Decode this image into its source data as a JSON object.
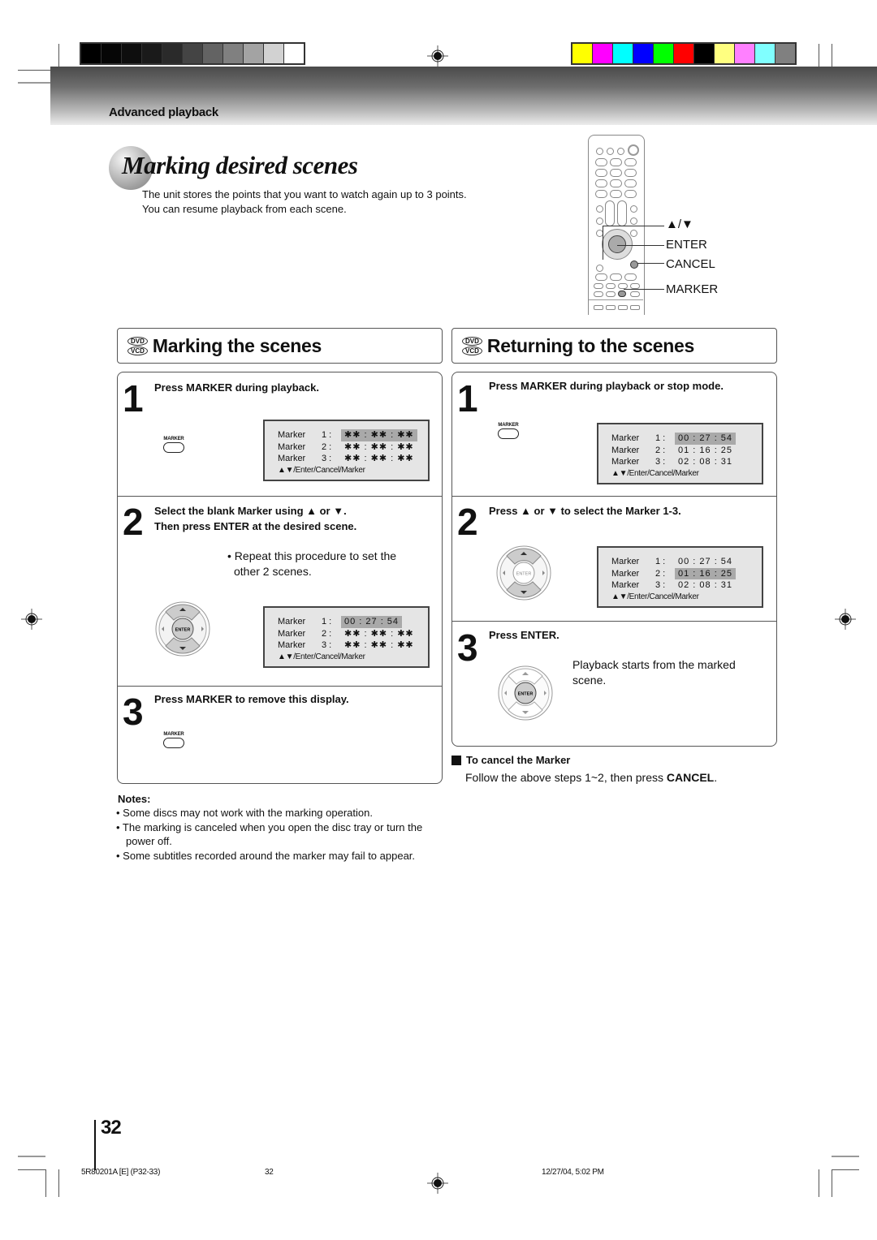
{
  "header": {
    "section_label": "Advanced playback",
    "grayscale_bars": [
      "#000000",
      "#060606",
      "#0e0e0e",
      "#1a1a1a",
      "#2a2a2a",
      "#444444",
      "#636363",
      "#808080",
      "#a3a3a3",
      "#d2d2d2",
      "#ffffff"
    ],
    "color_bars": [
      "#ffff00",
      "#ff00ff",
      "#00ffff",
      "#0000ff",
      "#00ff00",
      "#ff0000",
      "#000000",
      "#ffff80",
      "#ff80ff",
      "#80ffff",
      "#808080"
    ]
  },
  "title": "Marking desired scenes",
  "intro": {
    "line1": "The unit stores the points that you want to watch again up to 3 points.",
    "line2": "You can resume playback from each scene."
  },
  "remote": {
    "labels": {
      "arrows": "▲/▼",
      "enter": "ENTER",
      "cancel": "CANCEL",
      "marker": "MARKER"
    }
  },
  "disc_badges": {
    "dvd": "DVD",
    "vcd": "VCD"
  },
  "marking": {
    "heading": "Marking the scenes",
    "steps": [
      {
        "number": "1",
        "instruction": "Press MARKER during playback.",
        "button_label": "MARKER",
        "osd": {
          "rows": [
            {
              "label": "Marker",
              "num": "1 :",
              "value": "✱✱ : ✱✱ : ✱✱",
              "selected": true
            },
            {
              "label": "Marker",
              "num": "2 :",
              "value": "✱✱ : ✱✱ : ✱✱",
              "selected": false
            },
            {
              "label": "Marker",
              "num": "3 :",
              "value": "✱✱ : ✱✱ : ✱✱",
              "selected": false
            }
          ],
          "footer": "▲▼/Enter/Cancel/Marker"
        }
      },
      {
        "number": "2",
        "instruction_line1": "Select the blank Marker using ▲ or ▼.",
        "instruction_line2": "Then press ENTER at the desired scene.",
        "bullet": "• Repeat this procedure to set the",
        "bullet_cont": "other 2 scenes.",
        "enter_label": "ENTER",
        "osd": {
          "rows": [
            {
              "label": "Marker",
              "num": "1 :",
              "value": "00 : 27 : 54",
              "selected": true
            },
            {
              "label": "Marker",
              "num": "2 :",
              "value": "✱✱ : ✱✱ : ✱✱",
              "selected": false
            },
            {
              "label": "Marker",
              "num": "3 :",
              "value": "✱✱ : ✱✱ : ✱✱",
              "selected": false
            }
          ],
          "footer": "▲▼/Enter/Cancel/Marker"
        }
      },
      {
        "number": "3",
        "instruction": "Press MARKER to remove this display.",
        "button_label": "MARKER"
      }
    ]
  },
  "returning": {
    "heading": "Returning to the scenes",
    "steps": [
      {
        "number": "1",
        "instruction": "Press MARKER during playback or stop mode.",
        "button_label": "MARKER",
        "osd": {
          "rows": [
            {
              "label": "Marker",
              "num": "1 :",
              "value": "00 : 27 : 54",
              "selected": true
            },
            {
              "label": "Marker",
              "num": "2 :",
              "value": "01 : 16 : 25",
              "selected": false
            },
            {
              "label": "Marker",
              "num": "3 :",
              "value": "02 : 08 : 31",
              "selected": false
            }
          ],
          "footer": "▲▼/Enter/Cancel/Marker"
        }
      },
      {
        "number": "2",
        "instruction": "Press ▲ or ▼ to select the Marker 1-3.",
        "enter_label": "ENTER",
        "osd": {
          "rows": [
            {
              "label": "Marker",
              "num": "1 :",
              "value": "00 : 27 : 54",
              "selected": false
            },
            {
              "label": "Marker",
              "num": "2 :",
              "value": "01 : 16 : 25",
              "selected": true
            },
            {
              "label": "Marker",
              "num": "3 :",
              "value": "02 : 08 : 31",
              "selected": false
            }
          ],
          "footer": "▲▼/Enter/Cancel/Marker"
        }
      },
      {
        "number": "3",
        "instruction": "Press ENTER.",
        "enter_label": "ENTER",
        "body_line1": "Playback starts from the marked",
        "body_line2": "scene."
      }
    ],
    "cancel": {
      "heading": "To cancel the Marker",
      "text_prefix": "Follow the above steps 1~2, then press ",
      "text_bold": "CANCEL",
      "text_suffix": "."
    }
  },
  "notes": {
    "title": "Notes:",
    "items": [
      "• Some discs may not work with the marking operation.",
      "• The marking is canceled when you open the disc tray or turn the power off.",
      "• Some subtitles recorded around the marker may fail to appear."
    ]
  },
  "page_number": "32",
  "footer": {
    "left": "5R80201A [E] (P32-33)",
    "center": "32",
    "right": "12/27/04, 5:02 PM"
  }
}
